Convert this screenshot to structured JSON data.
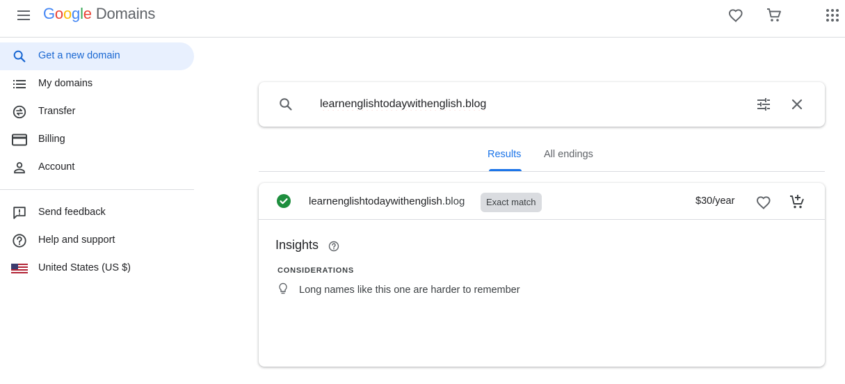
{
  "header": {
    "logo_letters": [
      "G",
      "o",
      "o",
      "g",
      "l",
      "e"
    ],
    "product": "Domains",
    "favorites_icon": "heart-outline-icon",
    "cart_icon": "shopping-cart-icon",
    "apps_icon": "apps-grid-icon"
  },
  "sidebar": {
    "items": [
      {
        "label": "Get a new domain",
        "icon": "search-icon",
        "active": true
      },
      {
        "label": "My domains",
        "icon": "list-icon"
      },
      {
        "label": "Transfer",
        "icon": "transfer-icon"
      },
      {
        "label": "Billing",
        "icon": "credit-card-icon"
      },
      {
        "label": "Account",
        "icon": "person-icon"
      }
    ],
    "secondary": [
      {
        "label": "Send feedback",
        "icon": "feedback-icon"
      },
      {
        "label": "Help and support",
        "icon": "help-icon"
      },
      {
        "label": "United States (US $)",
        "icon": "us-flag-icon"
      }
    ]
  },
  "search": {
    "value": "learnenglishtodaywithenglish.blog",
    "placeholder": ""
  },
  "tabs": [
    {
      "label": "Results",
      "active": true
    },
    {
      "label": "All endings",
      "active": false
    }
  ],
  "result": {
    "name": "learnenglishtodaywithenglish",
    "tld": ".blog",
    "badge": "Exact match",
    "price": "$30/year"
  },
  "insights": {
    "title": "Insights",
    "section_label": "CONSIDERATIONS",
    "items": [
      "Long names like this one are harder to remember"
    ]
  },
  "colors": {
    "accent": "#1a73e8",
    "active_nav_bg": "#e8f0fe",
    "available_green": "#1e8e3e",
    "badge_bg": "#dadce0"
  }
}
